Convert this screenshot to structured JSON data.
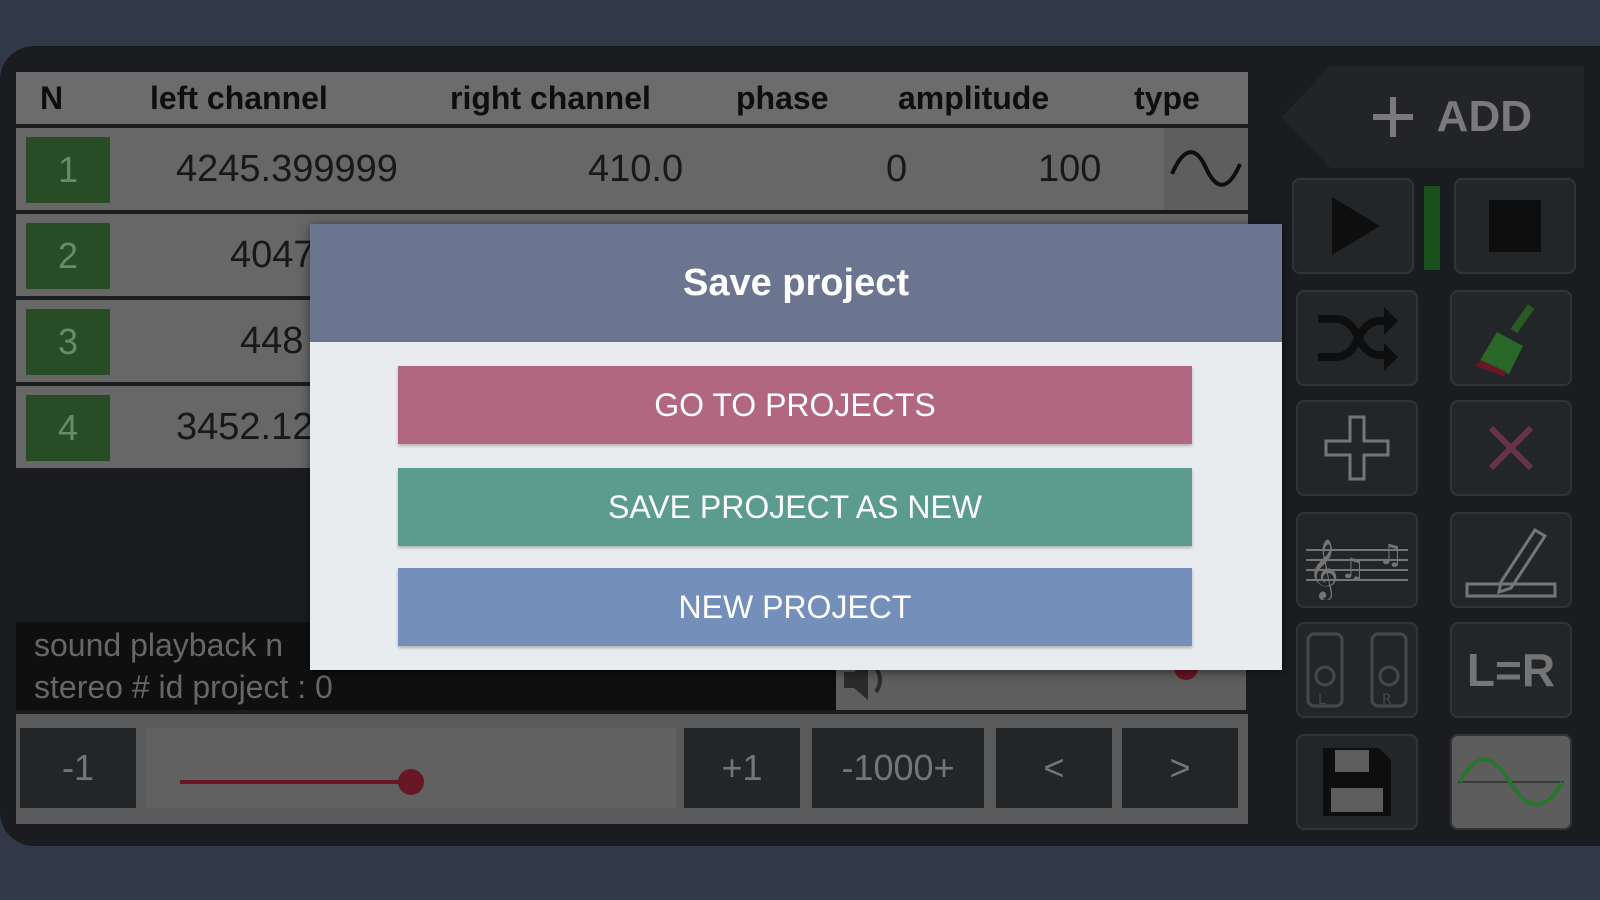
{
  "table": {
    "headers": {
      "n": "N",
      "left": "left channel",
      "right": "right channel",
      "phase": "phase",
      "amplitude": "amplitude",
      "type": "type"
    },
    "rows": [
      {
        "n": "1",
        "left": "4245.399999",
        "right": "410.0",
        "phase": "0",
        "amplitude": "100",
        "type_icon": "sine-wave-icon"
      },
      {
        "n": "2",
        "left": "4047"
      },
      {
        "n": "3",
        "left": "448"
      },
      {
        "n": "4",
        "left": "3452.12"
      }
    ]
  },
  "status": {
    "line1": "sound playback n",
    "line2": "stereo # id project : 0"
  },
  "bottom_bar": {
    "minus_label": "-1",
    "plus_label": "+1",
    "range_label": "-1000+",
    "prev_label": "<",
    "next_label": ">"
  },
  "right_panel": {
    "add_label": "ADD",
    "lr_label": "L=R",
    "icons": [
      "plus-icon",
      "play-icon",
      "stop-icon",
      "shuffle-icon",
      "broom-icon",
      "plus-icon",
      "close-icon",
      "music-notes-icon",
      "pencil-icon",
      "lr-speakers-icon",
      "save-icon",
      "sine-wave-icon"
    ]
  },
  "dialog": {
    "title": "Save project",
    "btn_projects": "GO TO PROJECTS",
    "btn_save_new": "SAVE PROJECT AS NEW",
    "btn_new": "NEW PROJECT"
  },
  "colors": {
    "btn_projects": "#b0677f",
    "btn_save_new": "#5b9c8f",
    "btn_new": "#738fba",
    "dialog_header": "#6b7590",
    "row_number_bg": "#2f5a2d"
  }
}
